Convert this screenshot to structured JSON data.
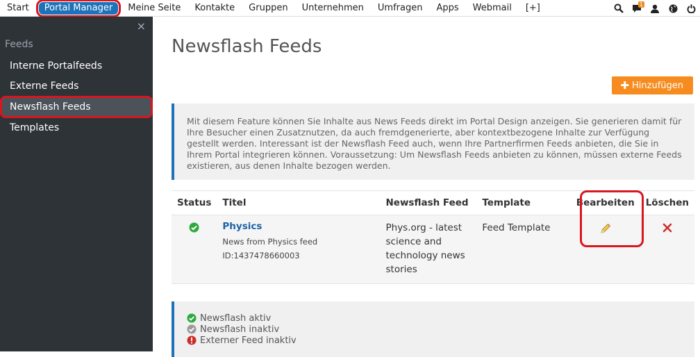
{
  "topnav": {
    "items": [
      "Start",
      "Portal Manager",
      "Meine Seite",
      "Kontakte",
      "Gruppen",
      "Unternehmen",
      "Umfragen",
      "Apps",
      "Webmail",
      "[+]"
    ],
    "notification_count": "1"
  },
  "sidebar": {
    "close": "×",
    "section": "Feeds",
    "items": [
      "Interne Portalfeeds",
      "Externe Feeds",
      "Newsflash Feeds",
      "Templates"
    ]
  },
  "main": {
    "title": "Newsflash Feeds",
    "add_button": "Hinzufügen",
    "info": "Mit diesem Feature können Sie Inhalte aus News Feeds direkt im Portal Design anzeigen. Sie generieren damit für Ihre Besucher einen Zusatznutzen, da auch fremdgenerierte, aber kontextbezogene Inhalte zur Verfügung gestellt werden. Interessant ist der Newsflash Feed auch, wenn Ihre Partnerfirmen Feeds anbieten, die Sie in Ihrem Portal integrieren können. Voraussetzung: Um Newsflash Feeds anbieten zu können, müssen externe Feeds existieren, aus denen Inhalte bezogen werden.",
    "table": {
      "headers": [
        "Status",
        "Titel",
        "Newsflash Feed",
        "Template",
        "Bearbeiten",
        "Löschen"
      ],
      "rows": [
        {
          "title": "Physics",
          "subtitle": "News from Physics feed",
          "id": "ID:1437478660003",
          "feed": "Phys.org - latest science and technology news stories",
          "template": "Feed Template"
        }
      ]
    },
    "legend": [
      "Newsflash aktiv",
      "Newsflash inaktiv",
      "Externer Feed inaktiv"
    ]
  },
  "colors": {
    "accent": "#1d72b8",
    "orange": "#f68c1f",
    "highlight": "#d9161f",
    "active_green": "#2eaa3c",
    "inactive_gray": "#9a9a9a",
    "error_red": "#c9302c"
  }
}
